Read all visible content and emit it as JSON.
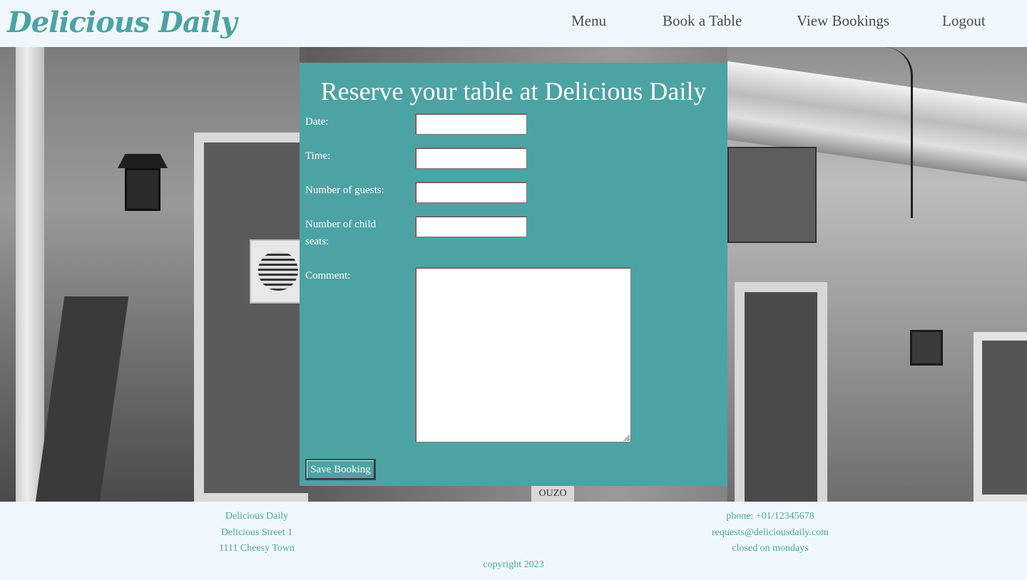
{
  "brand": {
    "name": "Delicious Daily"
  },
  "nav": {
    "items": [
      {
        "label": "Menu"
      },
      {
        "label": "Book a Table"
      },
      {
        "label": "View Bookings"
      },
      {
        "label": "Logout"
      }
    ]
  },
  "form": {
    "title": "Reserve your table at Delicious Daily",
    "fields": {
      "date_label": "Date:",
      "date_value": "",
      "time_label": "Time:",
      "time_value": "",
      "guests_label": "Number of guests:",
      "guests_value": "",
      "child_seats_label": "Number of child seats:",
      "child_seats_value": "",
      "comment_label": "Comment:",
      "comment_value": ""
    },
    "submit_label": "Save Booking"
  },
  "hero": {
    "sign_text": "OUZO"
  },
  "footer": {
    "address": {
      "name": "Delicious Daily",
      "street": "Delicious Street 1",
      "city": "1111 Cheesy Town"
    },
    "contact": {
      "phone": "phone: +01/12345678",
      "email": "requests@deliciousdaily.com",
      "hours": "closed on mondays"
    },
    "copyright": "copyright 2023"
  },
  "colors": {
    "accent": "#4ca3a3",
    "header_bg": "#f0f8fd",
    "nav_text": "#4a4a4a"
  }
}
